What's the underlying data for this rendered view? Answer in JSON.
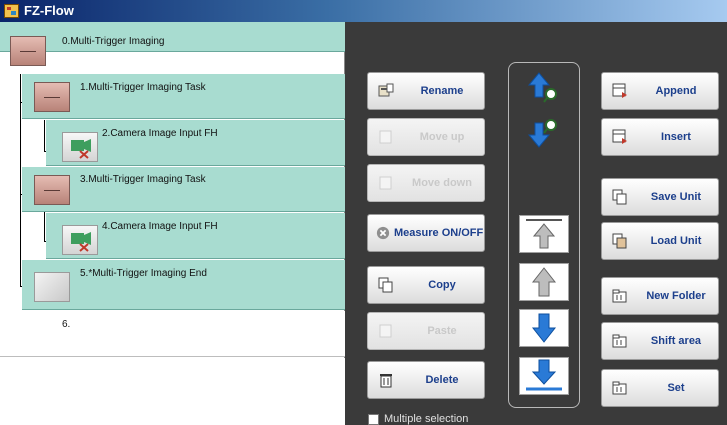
{
  "window": {
    "title": "FZ-Flow"
  },
  "flow": {
    "items": [
      {
        "number": "0.",
        "label": "0.Multi-Trigger Imaging"
      },
      {
        "label": "1.Multi-Trigger Imaging Task"
      },
      {
        "label": "2.Camera Image Input FH"
      },
      {
        "label": "3.Multi-Trigger Imaging Task"
      },
      {
        "label": "4.Camera Image Input FH"
      },
      {
        "label": "5.*Multi-Trigger Imaging End"
      },
      {
        "label": "6."
      }
    ]
  },
  "buttons": {
    "rename": "Rename",
    "move_up": "Move up",
    "move_down": "Move down",
    "measure": "Measure ON/OFF",
    "copy": "Copy",
    "paste": "Paste",
    "delete": "Delete",
    "append": "Append",
    "insert": "Insert",
    "save_unit": "Save Unit",
    "load_unit": "Load Unit",
    "new_folder": "New Folder",
    "shift_area": "Shift area",
    "set": "Set"
  },
  "options": {
    "multiple_selection": "Multiple selection",
    "multiple_selection_checked": false
  },
  "colors": {
    "flow_row": "#a8dcd0",
    "panel_bg": "#3a3a3a",
    "button_text": "#1c3f8c",
    "arrow_blue": "#2a7ad6"
  }
}
